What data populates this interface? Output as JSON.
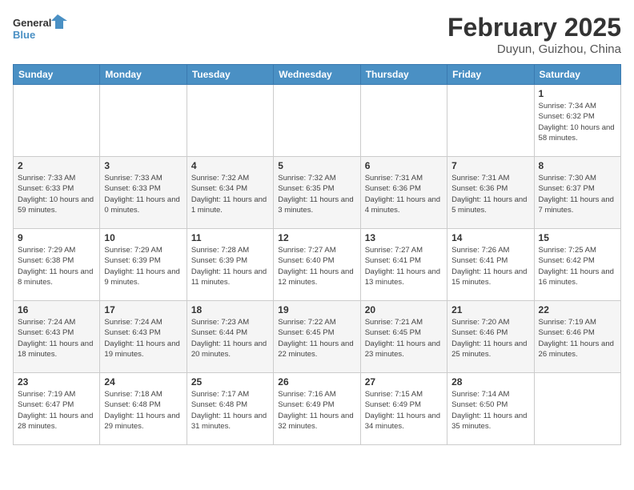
{
  "header": {
    "logo_line1": "General",
    "logo_line2": "Blue",
    "month": "February 2025",
    "location": "Duyun, Guizhou, China"
  },
  "days_of_week": [
    "Sunday",
    "Monday",
    "Tuesday",
    "Wednesday",
    "Thursday",
    "Friday",
    "Saturday"
  ],
  "weeks": [
    [
      {
        "day": "",
        "info": ""
      },
      {
        "day": "",
        "info": ""
      },
      {
        "day": "",
        "info": ""
      },
      {
        "day": "",
        "info": ""
      },
      {
        "day": "",
        "info": ""
      },
      {
        "day": "",
        "info": ""
      },
      {
        "day": "1",
        "info": "Sunrise: 7:34 AM\nSunset: 6:32 PM\nDaylight: 10 hours and 58 minutes."
      }
    ],
    [
      {
        "day": "2",
        "info": "Sunrise: 7:33 AM\nSunset: 6:33 PM\nDaylight: 10 hours and 59 minutes."
      },
      {
        "day": "3",
        "info": "Sunrise: 7:33 AM\nSunset: 6:33 PM\nDaylight: 11 hours and 0 minutes."
      },
      {
        "day": "4",
        "info": "Sunrise: 7:32 AM\nSunset: 6:34 PM\nDaylight: 11 hours and 1 minute."
      },
      {
        "day": "5",
        "info": "Sunrise: 7:32 AM\nSunset: 6:35 PM\nDaylight: 11 hours and 3 minutes."
      },
      {
        "day": "6",
        "info": "Sunrise: 7:31 AM\nSunset: 6:36 PM\nDaylight: 11 hours and 4 minutes."
      },
      {
        "day": "7",
        "info": "Sunrise: 7:31 AM\nSunset: 6:36 PM\nDaylight: 11 hours and 5 minutes."
      },
      {
        "day": "8",
        "info": "Sunrise: 7:30 AM\nSunset: 6:37 PM\nDaylight: 11 hours and 7 minutes."
      }
    ],
    [
      {
        "day": "9",
        "info": "Sunrise: 7:29 AM\nSunset: 6:38 PM\nDaylight: 11 hours and 8 minutes."
      },
      {
        "day": "10",
        "info": "Sunrise: 7:29 AM\nSunset: 6:39 PM\nDaylight: 11 hours and 9 minutes."
      },
      {
        "day": "11",
        "info": "Sunrise: 7:28 AM\nSunset: 6:39 PM\nDaylight: 11 hours and 11 minutes."
      },
      {
        "day": "12",
        "info": "Sunrise: 7:27 AM\nSunset: 6:40 PM\nDaylight: 11 hours and 12 minutes."
      },
      {
        "day": "13",
        "info": "Sunrise: 7:27 AM\nSunset: 6:41 PM\nDaylight: 11 hours and 13 minutes."
      },
      {
        "day": "14",
        "info": "Sunrise: 7:26 AM\nSunset: 6:41 PM\nDaylight: 11 hours and 15 minutes."
      },
      {
        "day": "15",
        "info": "Sunrise: 7:25 AM\nSunset: 6:42 PM\nDaylight: 11 hours and 16 minutes."
      }
    ],
    [
      {
        "day": "16",
        "info": "Sunrise: 7:24 AM\nSunset: 6:43 PM\nDaylight: 11 hours and 18 minutes."
      },
      {
        "day": "17",
        "info": "Sunrise: 7:24 AM\nSunset: 6:43 PM\nDaylight: 11 hours and 19 minutes."
      },
      {
        "day": "18",
        "info": "Sunrise: 7:23 AM\nSunset: 6:44 PM\nDaylight: 11 hours and 20 minutes."
      },
      {
        "day": "19",
        "info": "Sunrise: 7:22 AM\nSunset: 6:45 PM\nDaylight: 11 hours and 22 minutes."
      },
      {
        "day": "20",
        "info": "Sunrise: 7:21 AM\nSunset: 6:45 PM\nDaylight: 11 hours and 23 minutes."
      },
      {
        "day": "21",
        "info": "Sunrise: 7:20 AM\nSunset: 6:46 PM\nDaylight: 11 hours and 25 minutes."
      },
      {
        "day": "22",
        "info": "Sunrise: 7:19 AM\nSunset: 6:46 PM\nDaylight: 11 hours and 26 minutes."
      }
    ],
    [
      {
        "day": "23",
        "info": "Sunrise: 7:19 AM\nSunset: 6:47 PM\nDaylight: 11 hours and 28 minutes."
      },
      {
        "day": "24",
        "info": "Sunrise: 7:18 AM\nSunset: 6:48 PM\nDaylight: 11 hours and 29 minutes."
      },
      {
        "day": "25",
        "info": "Sunrise: 7:17 AM\nSunset: 6:48 PM\nDaylight: 11 hours and 31 minutes."
      },
      {
        "day": "26",
        "info": "Sunrise: 7:16 AM\nSunset: 6:49 PM\nDaylight: 11 hours and 32 minutes."
      },
      {
        "day": "27",
        "info": "Sunrise: 7:15 AM\nSunset: 6:49 PM\nDaylight: 11 hours and 34 minutes."
      },
      {
        "day": "28",
        "info": "Sunrise: 7:14 AM\nSunset: 6:50 PM\nDaylight: 11 hours and 35 minutes."
      },
      {
        "day": "",
        "info": ""
      }
    ]
  ]
}
